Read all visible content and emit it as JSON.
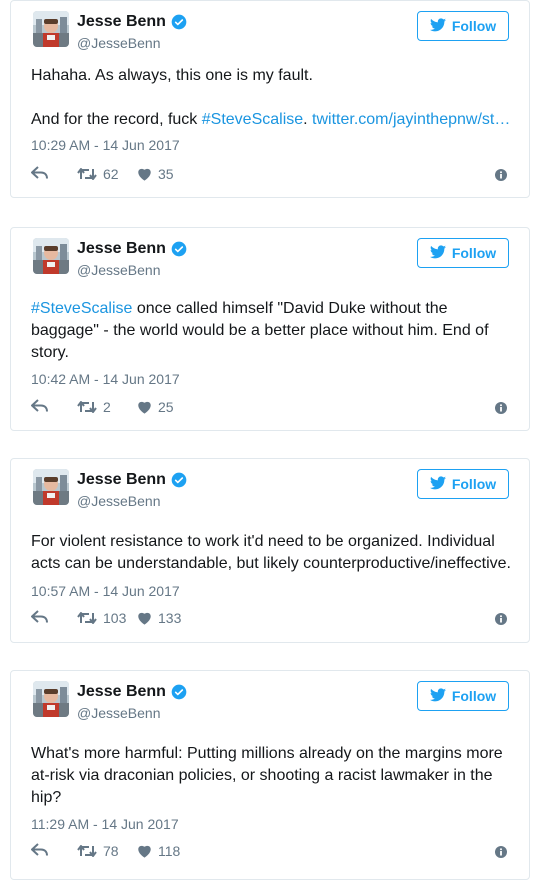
{
  "follow_label": "Follow",
  "colors": {
    "accent": "#1da1f2",
    "link": "#1b95e0",
    "muted": "#657786",
    "border": "#e1e8ed"
  },
  "icons": {
    "reply": "reply-icon",
    "retweet": "retweet-icon",
    "like": "heart-icon",
    "info": "info-icon",
    "verified": "verified-badge-icon",
    "bird": "twitter-bird-icon"
  },
  "tweets": [
    {
      "author": {
        "name": "Jesse Benn",
        "handle": "@JesseBenn"
      },
      "text_pre": "Hahaha. As always, this one is my fault.\n\nAnd for the record, fuck ",
      "hashtag": "#SteveScalise",
      "text_mid": ". ",
      "link": "twitter.com/jayinthepnw/st…",
      "text_post": "",
      "timestamp": "10:29 AM - 14 Jun 2017",
      "retweets": "62",
      "likes": "35"
    },
    {
      "author": {
        "name": "Jesse Benn",
        "handle": "@JesseBenn"
      },
      "text_pre": "",
      "hashtag": "#SteveScalise",
      "text_mid": " once called himself \"David Duke without the baggage\" - the world would be a better place without him. End of story.",
      "link": "",
      "text_post": "",
      "timestamp": "10:42 AM - 14 Jun 2017",
      "retweets": "2",
      "likes": "25"
    },
    {
      "author": {
        "name": "Jesse Benn",
        "handle": "@JesseBenn"
      },
      "text_pre": "For violent resistance to work it'd need to be organized. Individual acts can be understandable, but likely counterproductive/ineffective.",
      "hashtag": "",
      "text_mid": "",
      "link": "",
      "text_post": "",
      "timestamp": "10:57 AM - 14 Jun 2017",
      "retweets": "103",
      "likes": "133"
    },
    {
      "author": {
        "name": "Jesse Benn",
        "handle": "@JesseBenn"
      },
      "text_pre": "What's more harmful: Putting millions already on the margins more at-risk via draconian policies, or shooting a racist lawmaker in the hip?",
      "hashtag": "",
      "text_mid": "",
      "link": "",
      "text_post": "",
      "timestamp": "11:29 AM - 14 Jun 2017",
      "retweets": "78",
      "likes": "118"
    }
  ]
}
